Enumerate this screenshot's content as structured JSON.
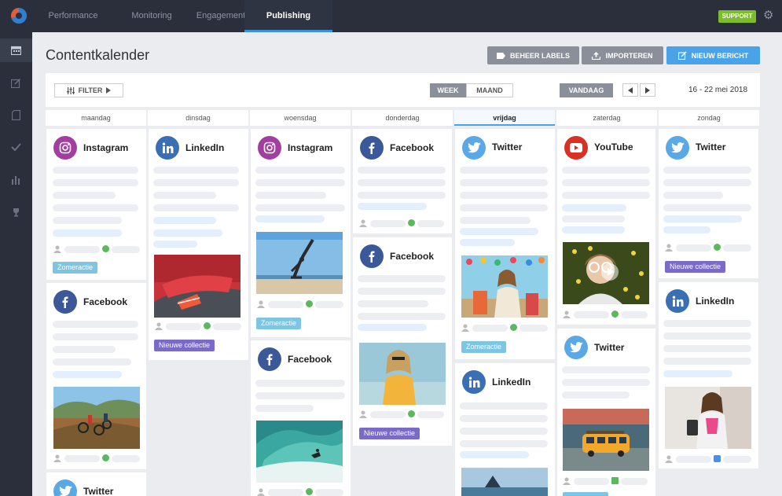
{
  "nav": {
    "tabs": [
      "Performance",
      "Monitoring",
      "Engagement",
      "Publishing"
    ],
    "active_tab": "Publishing",
    "support_label": "SUPPORT"
  },
  "sidebar": {
    "icons": [
      "calendar-icon",
      "edit-icon",
      "document-icon",
      "check-icon",
      "bar-chart-icon",
      "trophy-icon"
    ]
  },
  "page": {
    "title": "Contentkalender",
    "buttons": {
      "labels": "BEHEER LABELS",
      "import": "IMPORTEREN",
      "new_post": "NIEUW BERICHT"
    }
  },
  "toolbar": {
    "filter_label": "FILTER",
    "week_label": "WEEK",
    "month_label": "MAAND",
    "today_label": "VANDAAG",
    "date_range": "16 - 22 mei 2018"
  },
  "days": [
    "maandag",
    "dinsdag",
    "woensdag",
    "donderdag",
    "vrijdag",
    "zaterdag",
    "zondag"
  ],
  "today_day": "vrijdag",
  "colors": {
    "instagram": "#a33ea1",
    "linkedin": "#3b6fb3",
    "facebook": "#3b5998",
    "twitter": "#5aa8e6",
    "youtube": "#d93025",
    "tag_zomeractie": "#7ec4e3",
    "tag_nieuwe_collectie": "#7b6bc8",
    "status_green": "#5cb85c",
    "status_blue": "#4a90e2"
  },
  "posts": {
    "mon_1": {
      "network": "Instagram",
      "tag": "Zomeractie"
    },
    "mon_2": {
      "network": "Facebook"
    },
    "mon_3": {
      "network": "Twitter"
    },
    "tue_1": {
      "network": "LinkedIn",
      "tag": "Nieuwe collectie"
    },
    "wed_1": {
      "network": "Instagram",
      "tag": "Zomeractie"
    },
    "wed_2": {
      "network": "Facebook"
    },
    "thu_1": {
      "network": "Facebook"
    },
    "thu_2": {
      "network": "Facebook",
      "tag": "Nieuwe collectie"
    },
    "fri_1": {
      "network": "Twitter",
      "tag": "Zomeractie"
    },
    "fri_2": {
      "network": "LinkedIn"
    },
    "sat_1": {
      "network": "YouTube"
    },
    "sat_2": {
      "network": "Twitter"
    },
    "sun_1": {
      "network": "Twitter",
      "tag": "Nieuwe collectie"
    },
    "sun_2": {
      "network": "LinkedIn"
    }
  }
}
